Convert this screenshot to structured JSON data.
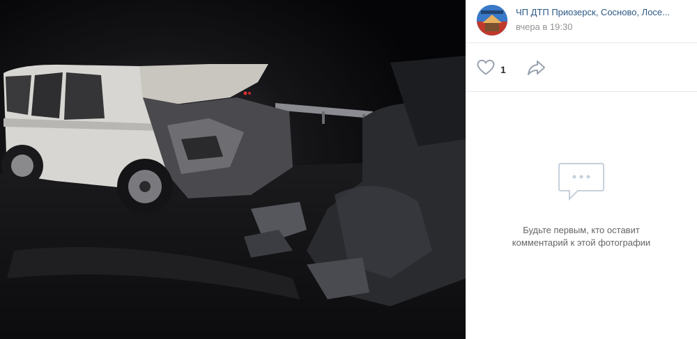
{
  "post": {
    "author": "ЧП ДТП Приозерск, Сосново, Лосе...",
    "date": "вчера в 19:30",
    "avatar_text": "ЧП ДТП Приозерск"
  },
  "actions": {
    "likes": "1",
    "like_icon": "heart-icon",
    "share_icon": "share-arrow-icon"
  },
  "comments": {
    "empty_line1": "Будьте первым, кто оставит",
    "empty_line2": "комментарий к этой фотографии",
    "icon": "comment-bubble-icon"
  },
  "colors": {
    "link": "#2a5885",
    "muted": "#939393",
    "icon": "#99a2ad",
    "accent": "#3a78c8"
  }
}
